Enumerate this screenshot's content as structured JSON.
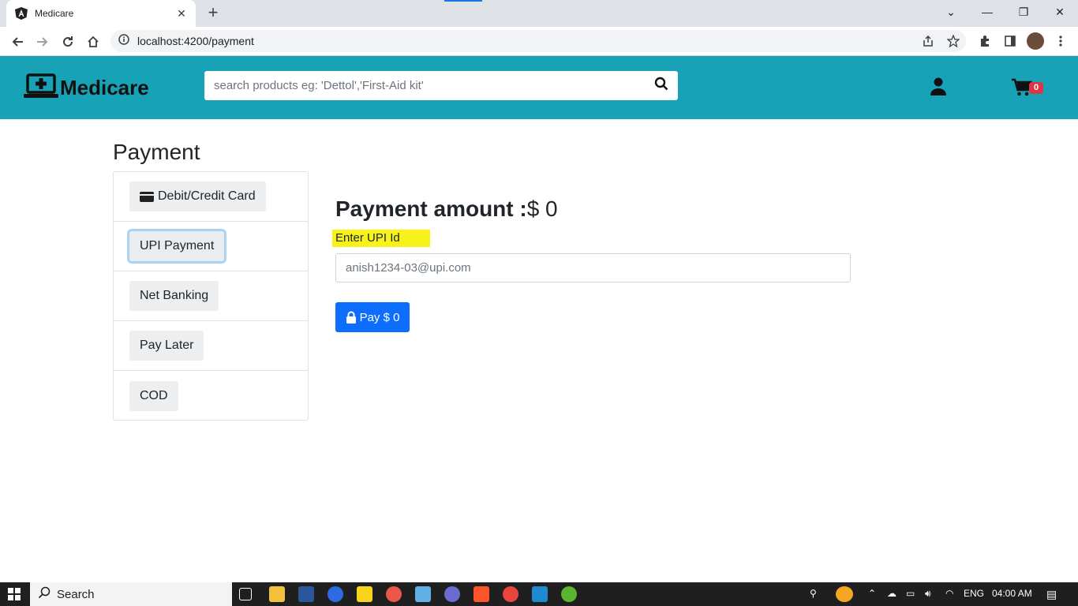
{
  "browser": {
    "tab_title": "Medicare",
    "url": "localhost:4200/payment"
  },
  "header": {
    "brand": "Medicare",
    "search_placeholder": "search products eg: 'Dettol','First-Aid kit'",
    "cart_count": "0"
  },
  "page": {
    "title": "Payment",
    "methods": [
      {
        "label": "Debit/Credit Card"
      },
      {
        "label": "UPI Payment"
      },
      {
        "label": "Net Banking"
      },
      {
        "label": "Pay Later"
      },
      {
        "label": "COD"
      }
    ],
    "active_method": "UPI Payment",
    "amount_label": "Payment amount :",
    "amount_value": "$ 0",
    "upi_label": "Enter UPI Id",
    "upi_placeholder": "anish1234-03@upi.com",
    "pay_button": "Pay $ 0"
  },
  "taskbar": {
    "search_label": "Search",
    "language": "ENG",
    "time": "04:00 AM"
  },
  "colors": {
    "header_bg": "#17a2b8",
    "primary": "#0d6efd",
    "badge": "#dc3545",
    "highlight": "#f7f21a"
  }
}
